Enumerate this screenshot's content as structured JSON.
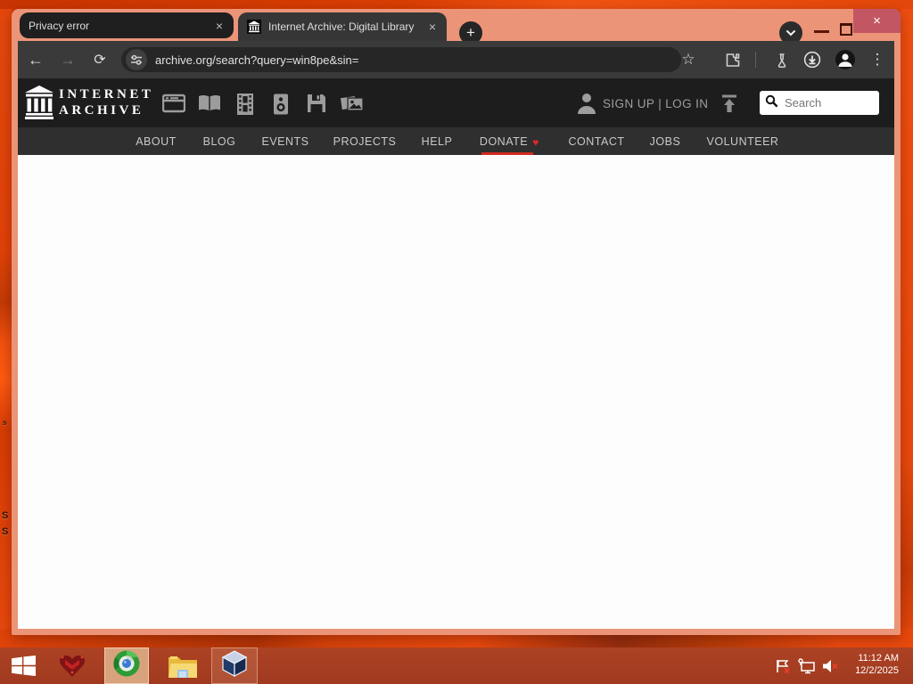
{
  "browser": {
    "tabs": [
      {
        "title": "Privacy error"
      },
      {
        "title": "Internet Archive: Digital Library"
      }
    ],
    "new_tab_glyph": "+",
    "close_glyph": "×",
    "url": "archive.org/search?query=win8pe&sin=",
    "glyphs": {
      "back": "←",
      "forward": "→",
      "reload": "⟳",
      "star": "☆",
      "menu": "⋮"
    }
  },
  "archive": {
    "brand_line1": "INTERNET",
    "brand_line2": "ARCHIVE",
    "auth_text": "SIGN UP | LOG IN",
    "search_placeholder": "Search",
    "donate_heart": "♥",
    "nav": [
      {
        "label": "ABOUT"
      },
      {
        "label": "BLOG"
      },
      {
        "label": "EVENTS"
      },
      {
        "label": "PROJECTS"
      },
      {
        "label": "HELP"
      },
      {
        "label": "DONATE"
      },
      {
        "label": "CONTACT"
      },
      {
        "label": "JOBS"
      },
      {
        "label": "VOLUNTEER"
      }
    ],
    "media_types": [
      "web",
      "texts",
      "video",
      "audio",
      "software",
      "images"
    ]
  },
  "taskbar": {
    "clock_time": "11:12 AM",
    "clock_date": "12/2/2025"
  },
  "desktop": {
    "fragments": [
      {
        "text": "s"
      },
      {
        "text": "S"
      },
      {
        "text": "S"
      }
    ]
  },
  "colors": {
    "frame_salmon": "#ec9478",
    "desktop_orange": "#e8490e",
    "close_red": "#c25763",
    "donate_red": "#cf2b1f"
  }
}
